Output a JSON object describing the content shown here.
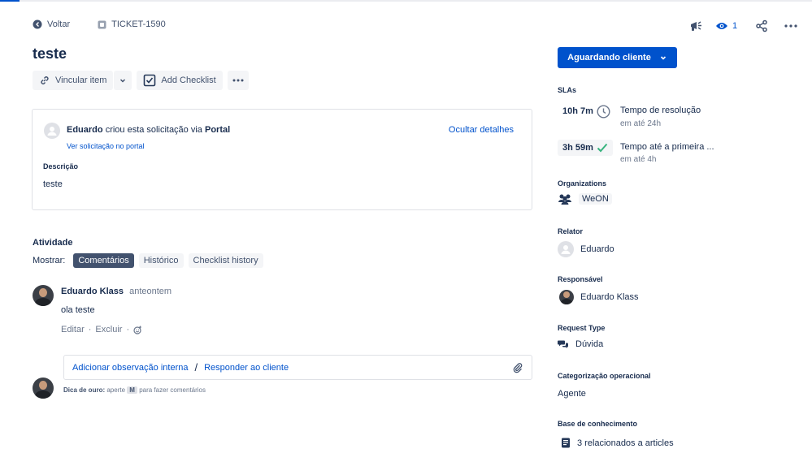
{
  "breadcrumb": {
    "back_label": "Voltar",
    "ticket_id": "TICKET-1590"
  },
  "issue": {
    "title": "teste"
  },
  "toolbar": {
    "link_label": "Vincular item",
    "checklist_label": "Add Checklist"
  },
  "details": {
    "author": "Eduardo",
    "created_text": "criou esta solicitação via",
    "channel": "Portal",
    "portal_link": "Ver solicitação no portal",
    "hide_details": "Ocultar detalhes",
    "description_label": "Descrição",
    "description_value": "teste"
  },
  "activity": {
    "title": "Atividade",
    "show_label": "Mostrar:",
    "filters": [
      "Comentários",
      "Histórico",
      "Checklist history"
    ],
    "active_filter": "Comentários"
  },
  "comment": {
    "author": "Eduardo Klass",
    "time": "anteontem",
    "body": "ola teste",
    "edit": "Editar",
    "delete": "Excluir",
    "dot": "·"
  },
  "reply": {
    "internal_note": "Adicionar observação interna",
    "slash": "/",
    "reply_customer": "Responder ao cliente",
    "tip_bold": "Dica de ouro:",
    "tip_press": "aperte",
    "tip_key": "M",
    "tip_rest": "para fazer comentários"
  },
  "header_actions": {
    "watch_count": "1"
  },
  "status": {
    "label": "Aguardando cliente"
  },
  "slas": {
    "title": "SLAs",
    "items": [
      {
        "time": "10h 7m",
        "name": "Tempo de resolução",
        "target": "em até 24h",
        "icon": "clock-icon"
      },
      {
        "time": "3h 59m",
        "name": "Tempo até a primeira ...",
        "target": "em até 4h",
        "icon": "check-icon"
      }
    ]
  },
  "fields": {
    "organizations_label": "Organizations",
    "organization": "WeON",
    "reporter_label": "Relator",
    "reporter": "Eduardo",
    "assignee_label": "Responsável",
    "assignee": "Eduardo Klass",
    "request_type_label": "Request Type",
    "request_type": "Dúvida",
    "category_label": "Categorização operacional",
    "category": "Agente",
    "kb_label": "Base de conhecimento",
    "kb_value": "3 relacionados a articles"
  },
  "colors": {
    "primary": "#0052cc",
    "text": "#172b4d",
    "muted": "#6b778c",
    "success": "#36b37e",
    "chip_active": "#42526e"
  }
}
